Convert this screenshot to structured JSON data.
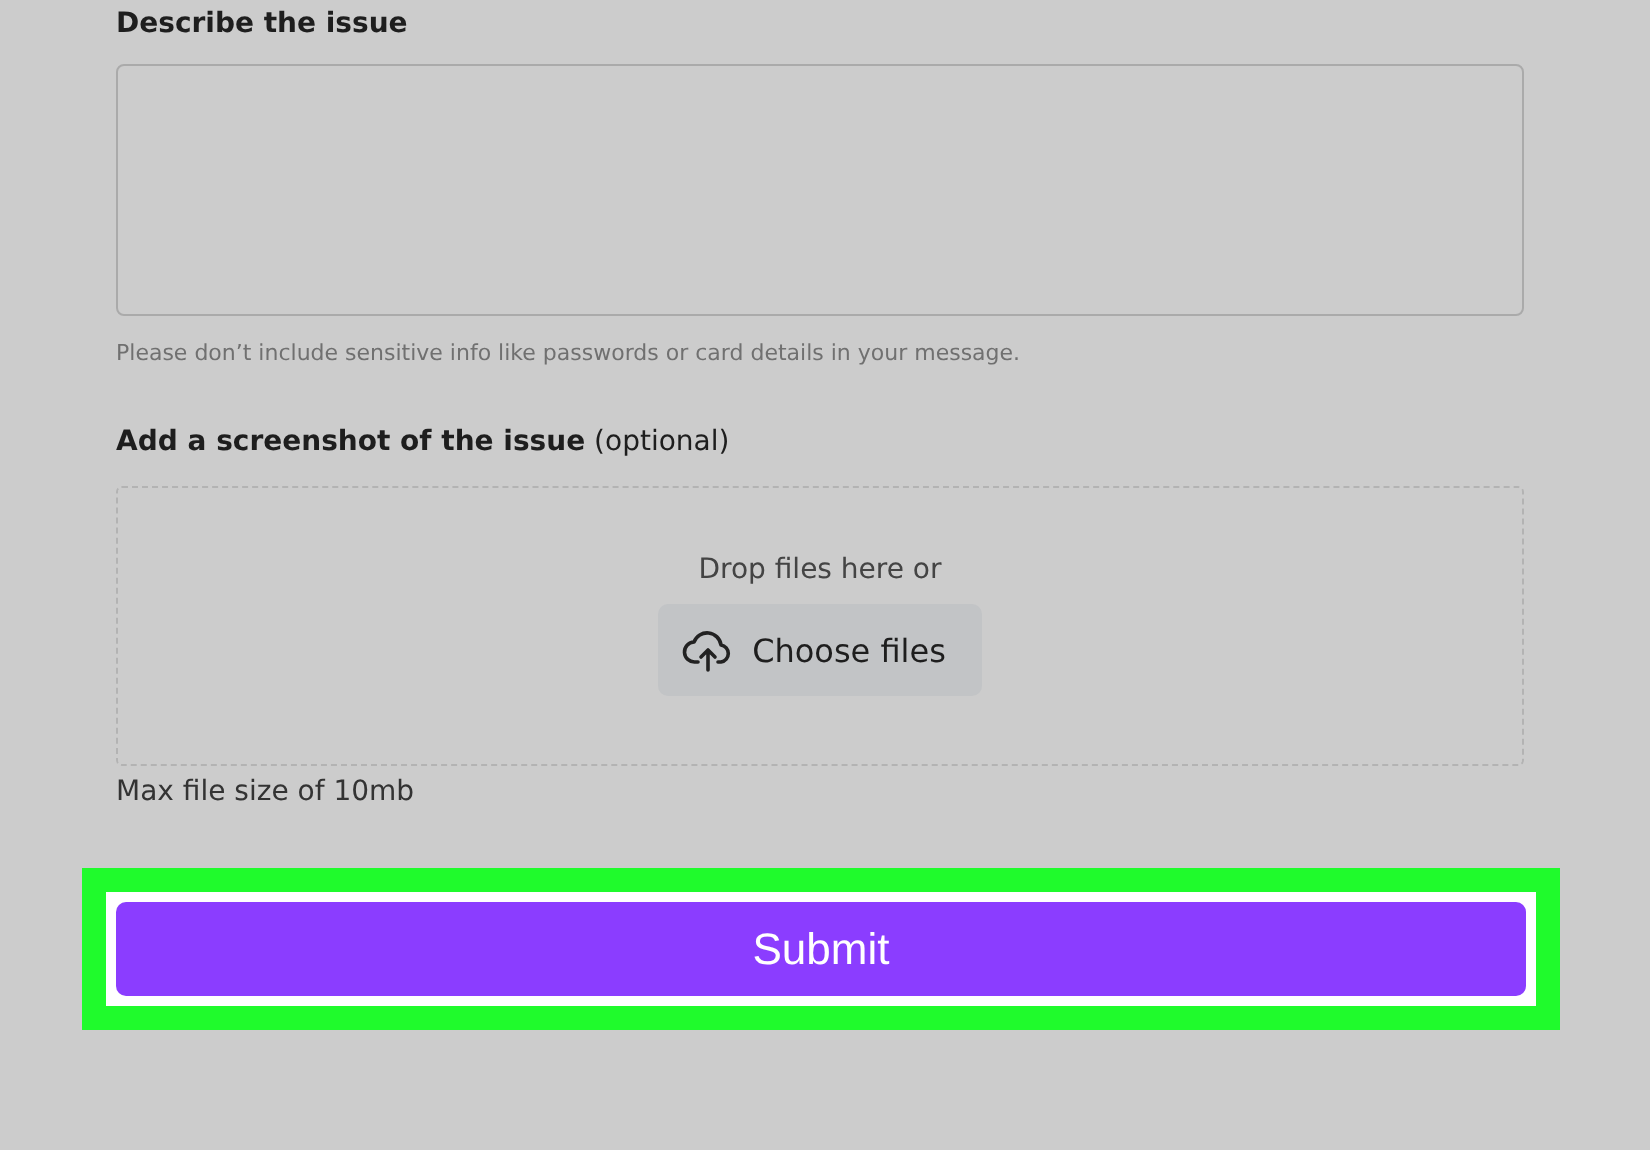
{
  "describe": {
    "label": "Describe the issue",
    "hint": "Please don’t include sensitive info like passwords or card details in your message."
  },
  "screenshot": {
    "label": "**Add a screenshot of the issue** (optional)",
    "drop_text": "Drop files here or",
    "button": "Choose files",
    "max_size": "Max file size of 10mb"
  },
  "submit": {
    "label": "Submit",
    "highlighted": true
  }
}
